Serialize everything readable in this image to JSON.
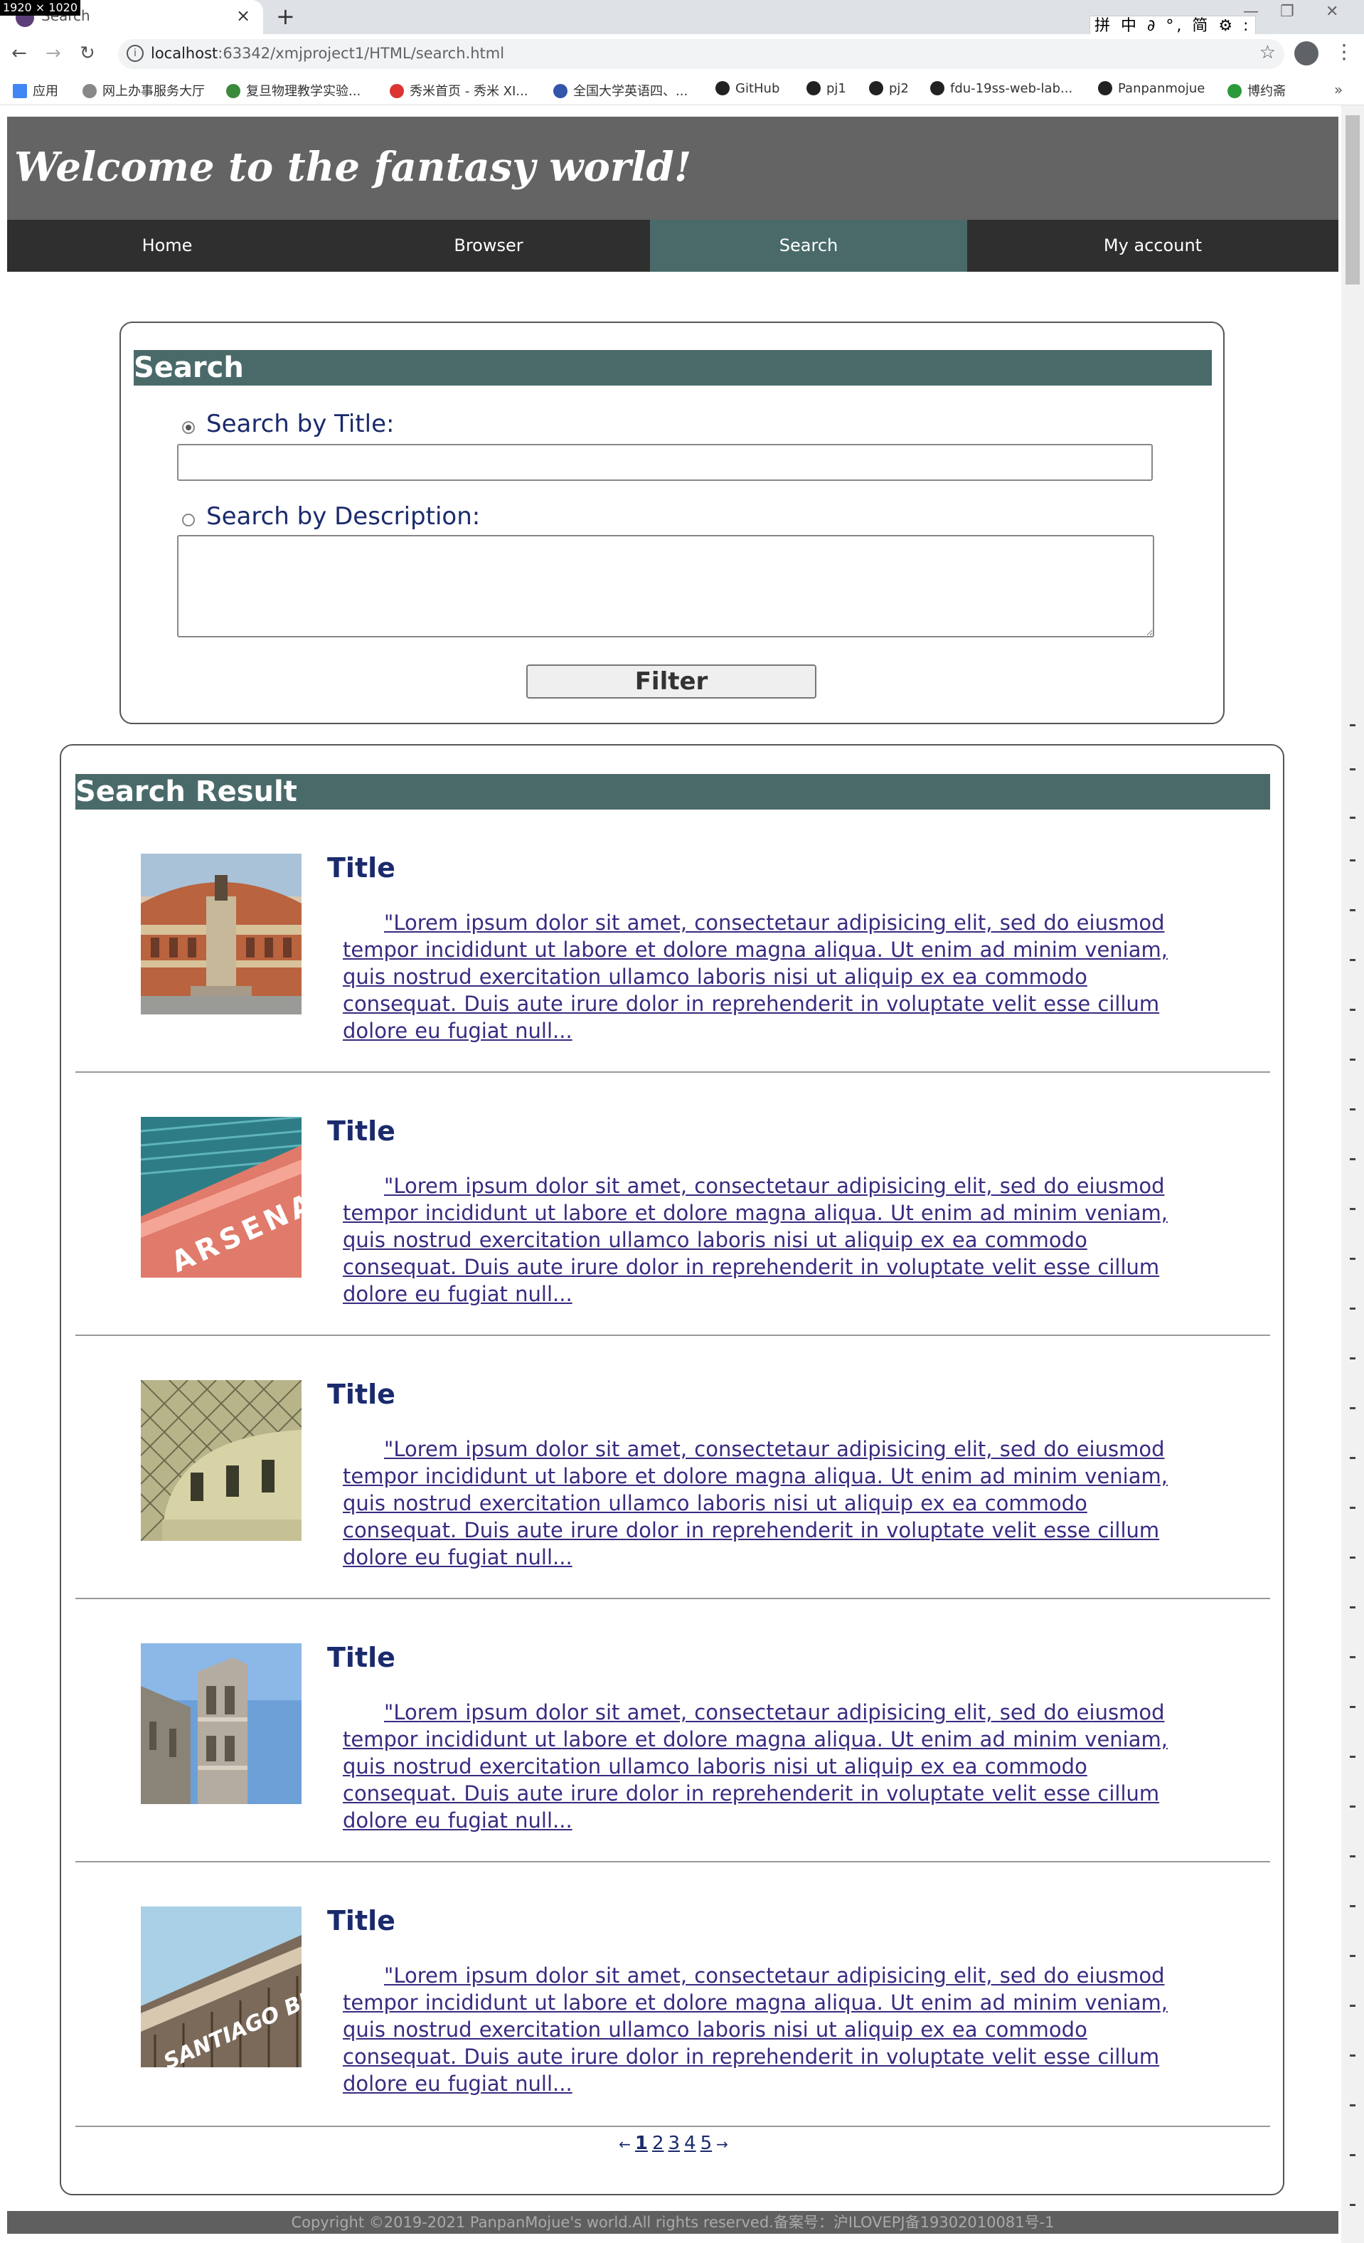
{
  "browser": {
    "resolution_badge": "1920 × 1020",
    "tab_title": "Search",
    "tab_close": "×",
    "new_tab": "+",
    "ime_status": "拼 中 ∂ °, 简 ⚙ :",
    "url_host": "localhost",
    "url_rest": ":63342/xmjproject1/HTML/search.html",
    "back": "←",
    "forward": "→",
    "reload": "↻",
    "star": "☆",
    "menu": "⋮",
    "minimize": "—",
    "restore": "❐",
    "close": "✕",
    "bookmarks": [
      {
        "label": "应用",
        "icon": "apps-icon"
      },
      {
        "label": "网上办事服务大厅",
        "icon": "home-icon"
      },
      {
        "label": "复旦物理教学实验...",
        "icon": "leaf-icon"
      },
      {
        "label": "秀米首页 - 秀米 XI...",
        "icon": "xiumi-icon"
      },
      {
        "label": "全国大学英语四、...",
        "icon": "globe-icon"
      },
      {
        "label": "GitHub",
        "icon": "github-icon"
      },
      {
        "label": "pj1",
        "icon": "github-icon"
      },
      {
        "label": "pj2",
        "icon": "github-icon"
      },
      {
        "label": "fdu-19ss-web-lab...",
        "icon": "github-icon"
      },
      {
        "label": "Panpanmojue",
        "icon": "github-icon"
      },
      {
        "label": "博约斋",
        "icon": "refresh-icon"
      }
    ],
    "bookmarks_more": "»"
  },
  "header": {
    "site_title": "Welcome to the fantasy world!"
  },
  "nav": {
    "items": [
      "Home",
      "Browser",
      "Search",
      "My account"
    ],
    "active": "Search"
  },
  "search": {
    "heading": "Search",
    "by_title_label": "Search by Title:",
    "by_title_value": "",
    "by_desc_label": "Search by Description:",
    "by_desc_value": "",
    "selected": "title",
    "filter_label": "Filter"
  },
  "results": {
    "heading": "Search Result",
    "items": [
      {
        "title": "Title",
        "image": "royal-albert-hall-photo",
        "desc": "\"Lorem ipsum dolor sit amet, consectetaur adipisicing elit, sed do eiusmod tempor incididunt ut labore et dolore magna aliqua. Ut enim ad minim veniam, quis nostrud exercitation ullamco laboris nisi ut aliquip ex ea commodo consequat. Duis aute irure dolor in reprehenderit in voluptate velit esse cillum dolore eu fugiat null..."
      },
      {
        "title": "Title",
        "image": "arsenal-stadium-photo",
        "desc": "\"Lorem ipsum dolor sit amet, consectetaur adipisicing elit, sed do eiusmod tempor incididunt ut labore et dolore magna aliqua. Ut enim ad minim veniam, quis nostrud exercitation ullamco laboris nisi ut aliquip ex ea commodo consequat. Duis aute irure dolor in reprehenderit in voluptate velit esse cillum dolore eu fugiat null..."
      },
      {
        "title": "Title",
        "image": "british-museum-photo",
        "desc": "\"Lorem ipsum dolor sit amet, consectetaur adipisicing elit, sed do eiusmod tempor incididunt ut labore et dolore magna aliqua. Ut enim ad minim veniam, quis nostrud exercitation ullamco laboris nisi ut aliquip ex ea commodo consequat. Duis aute irure dolor in reprehenderit in voluptate velit esse cillum dolore eu fugiat null..."
      },
      {
        "title": "Title",
        "image": "florence-tower-photo",
        "desc": "\"Lorem ipsum dolor sit amet, consectetaur adipisicing elit, sed do eiusmod tempor incididunt ut labore et dolore magna aliqua. Ut enim ad minim veniam, quis nostrud exercitation ullamco laboris nisi ut aliquip ex ea commodo consequat. Duis aute irure dolor in reprehenderit in voluptate velit esse cillum dolore eu fugiat null..."
      },
      {
        "title": "Title",
        "image": "santiago-bernabeu-photo",
        "desc": "\"Lorem ipsum dolor sit amet, consectetaur adipisicing elit, sed do eiusmod tempor incididunt ut labore et dolore magna aliqua. Ut enim ad minim veniam, quis nostrud exercitation ullamco laboris nisi ut aliquip ex ea commodo consequat. Duis aute irure dolor in reprehenderit in voluptate velit esse cillum dolore eu fugiat null..."
      }
    ]
  },
  "pager": {
    "prev": "←",
    "pages": [
      "1",
      "2",
      "3",
      "4",
      "5"
    ],
    "current": "1",
    "next": "→"
  },
  "footer": {
    "text": "Copyright ©2019-2021 PanpanMojue's world.All rights reserved.备案号：沪ILOVEPJ备19302010081号-1"
  },
  "colors": {
    "header_bg": "#646464",
    "nav_bg": "#2f2f2f",
    "accent": "#4a6a6a",
    "text_blue": "#1a2a6c"
  }
}
